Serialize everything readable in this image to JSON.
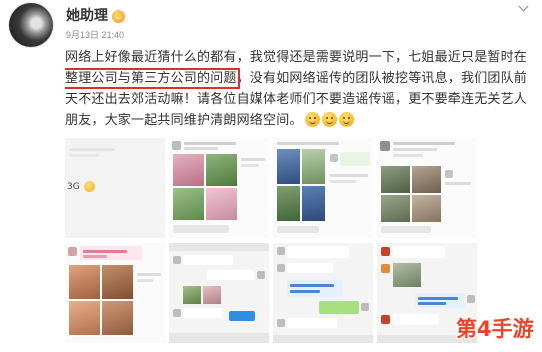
{
  "header": {
    "username": "她助理",
    "badge_icon": "vip-badge-icon",
    "timestamp": "9月13日 21:40",
    "menu_icon": "chevron-down-icon"
  },
  "post": {
    "line_1": "网络上好像最近猜什么的都有，我觉得还是需要说明一下，七姐最近只是暂时在",
    "line_2_highlight": "整理公司与第三方公司的问题",
    "line_2_rest": "，没有如网络谣传的团队被挖等讯息，我们团队前",
    "line_3": "天不还出去郊活动嘛！请各位自媒体老师们不要造谣传谣，更不要牵连无关艺人",
    "line_4": "朋友，大家一起共同维护清朗网络空间。",
    "emoji_icons": [
      "laugh-tears-emoji-icon",
      "laugh-tears-emoji-icon",
      "laugh-tears-emoji-icon"
    ],
    "highlight_color": "#d9302a"
  },
  "image_grid": {
    "image_1_text": "3G"
  },
  "watermark": {
    "text": "第4手游",
    "color": "#e8452a"
  }
}
